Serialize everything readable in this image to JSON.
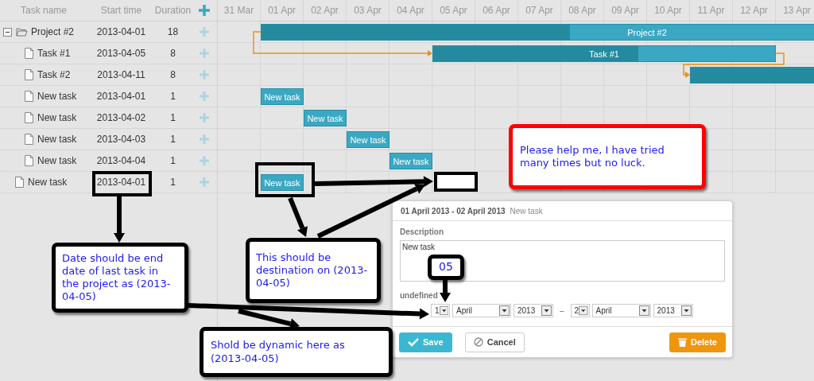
{
  "grid": {
    "columns": [
      "Task name",
      "Start time",
      "Duration"
    ],
    "rows": [
      {
        "kind": "project",
        "name": "Project #2",
        "start": "2013-04-01",
        "duration": "18",
        "expanded": true,
        "bar": {
          "label": "Project #2",
          "level": 0.4
        },
        "children": [
          {
            "kind": "task",
            "name": "Task #1",
            "start": "2013-04-05",
            "duration": "8",
            "link": {
              "kind": "start_to_start"
            },
            "bar": {
              "label": "Task #1",
              "level": 0.6
            }
          },
          {
            "kind": "task",
            "name": "Task #2",
            "start": "2013-04-11",
            "duration": "8",
            "link": {
              "kind": "finish_to_start"
            },
            "bar": {
              "level": 0.5
            }
          },
          {
            "kind": "task",
            "name": "New task",
            "start": "2013-04-01",
            "duration": "1",
            "bar": {
              "label": "New task"
            }
          },
          {
            "kind": "task",
            "name": "New task",
            "start": "2013-04-02",
            "duration": "1",
            "bar": {
              "label": "New task"
            }
          },
          {
            "kind": "task",
            "name": "New task",
            "start": "2013-04-03",
            "duration": "1",
            "bar": {
              "label": "New task"
            }
          },
          {
            "kind": "task",
            "name": "New task",
            "start": "2013-04-04",
            "duration": "1",
            "bar": {
              "label": "New task"
            }
          }
        ]
      },
      {
        "kind": "task",
        "name": "New task",
        "start": "2013-04-01",
        "duration": "1",
        "bar": {
          "label": "New task"
        }
      }
    ]
  },
  "timeline": {
    "scale": [
      "31 Mar",
      "01 Apr",
      "02 Apr",
      "03 Apr",
      "04 Apr",
      "05 Apr",
      "06 Apr",
      "07 Apr",
      "08 Apr",
      "09 Apr",
      "10 Apr",
      "11 Apr",
      "12 Apr",
      "13 Apr"
    ]
  },
  "lightbox": {
    "dates": "01 April 2013 - 02 April 2013",
    "title": "New task",
    "section": "Description",
    "description": "New task",
    "time_label": "undefined",
    "start": [
      "1",
      "April",
      "2013"
    ],
    "separator": "–",
    "end": [
      "2",
      "April",
      "2013"
    ],
    "buttons": [
      {
        "kind": "save",
        "label": "Save"
      },
      {
        "kind": "cancel",
        "label": "Cancel"
      },
      {
        "kind": "delete",
        "label": "Delete"
      }
    ]
  },
  "annotations": [
    {
      "kind": "note",
      "text": "Date should be end date of last task in the project as (2013-04-05)"
    },
    {
      "kind": "note",
      "text": "This should be destination on (2013-04-05)"
    },
    {
      "kind": "note",
      "text": "Shold be dynamic here as (2013-04-05)"
    },
    {
      "kind": "alert",
      "text": "Please help me, I have tried many times but no luck."
    },
    {
      "kind": "note",
      "text": "05"
    }
  ]
}
